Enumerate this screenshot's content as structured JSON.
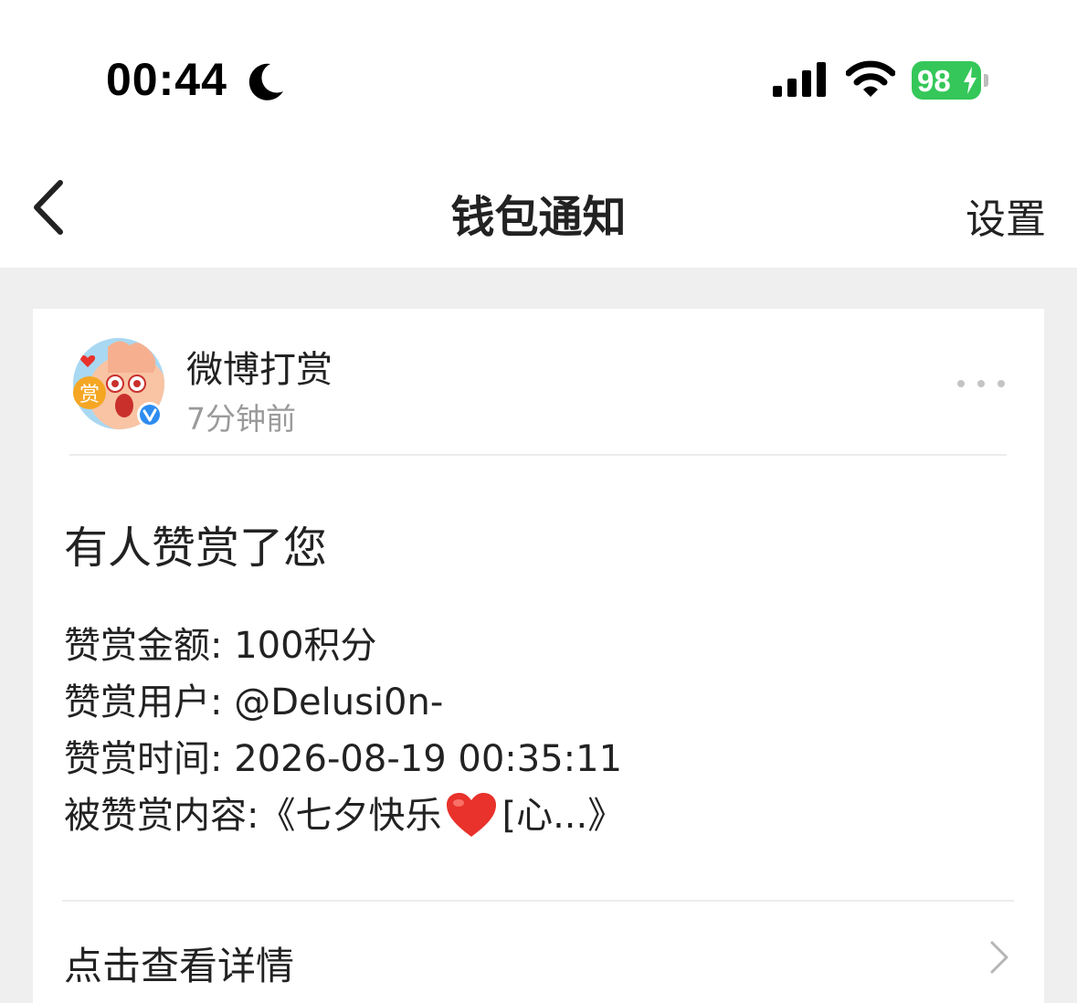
{
  "status_bar": {
    "time": "00:44",
    "battery": "98",
    "icons": [
      "moon-icon",
      "cellular-signal-icon",
      "wifi-icon",
      "battery-icon",
      "charging-bolt-icon"
    ],
    "battery_color": "#35c759"
  },
  "nav": {
    "title": "钱包通知",
    "settings_label": "设置",
    "back_icon": "chevron-left-icon"
  },
  "card": {
    "sender": "微博打赏",
    "time_ago": "7分钟前",
    "verified_badge": "verified-v-icon",
    "more_icon": "more-dots-icon",
    "title": "有人赞赏了您",
    "details": {
      "amount": "赞赏金额: 100积分",
      "user": "赞赏用户: @Delusi0n-",
      "time": "赞赏时间: 2026-08-19 00:35:11",
      "content_prefix": "被赞赏内容:《七夕快乐",
      "content_suffix": "[心...》"
    },
    "view_details_label": "点击查看详情",
    "chevron_icon": "chevron-right-icon",
    "accent_colors": {
      "verified_blue": "#2d8cf0",
      "heart_red": "#e8322b",
      "reward_badge_orange": "#f5a623"
    }
  }
}
